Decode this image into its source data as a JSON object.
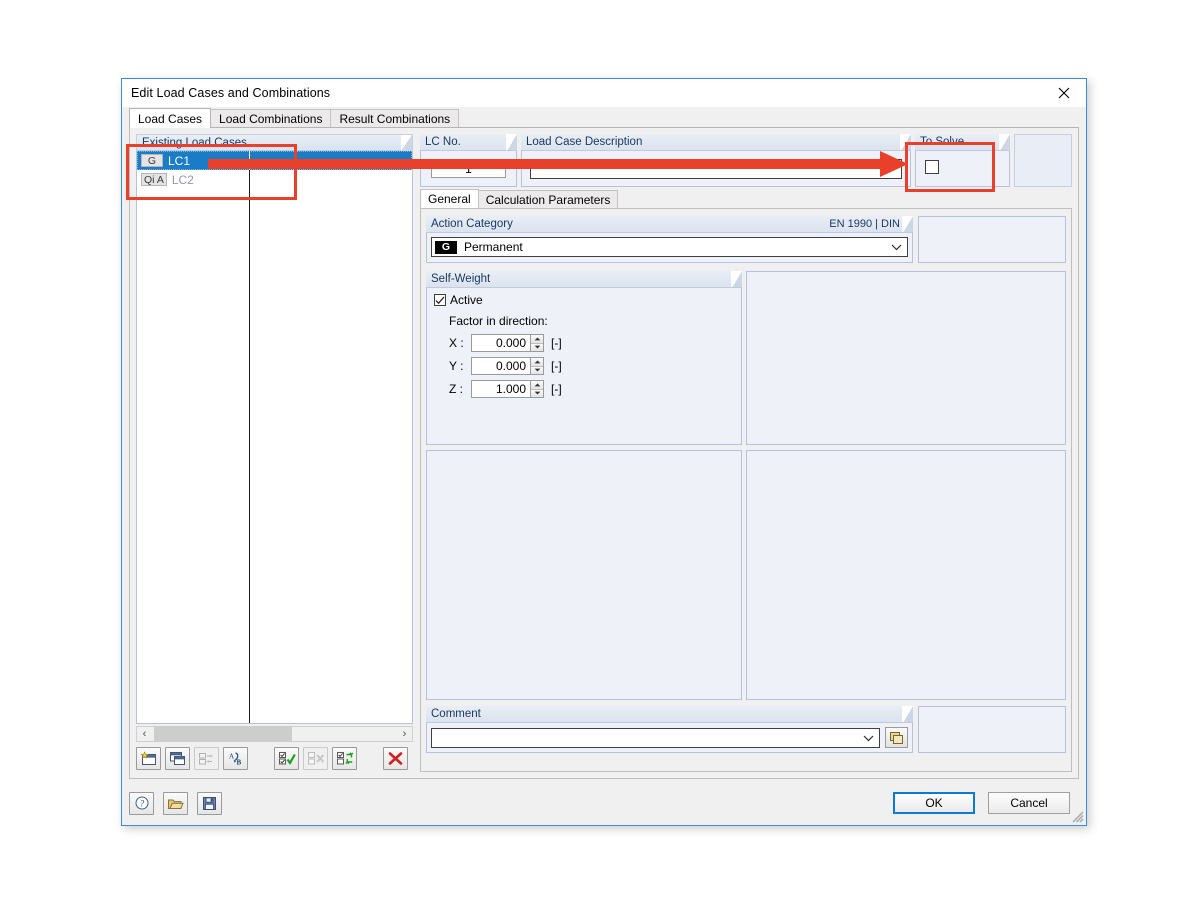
{
  "window": {
    "title": "Edit Load Cases and Combinations",
    "close_icon": "close-icon"
  },
  "tabs": [
    {
      "label": "Load Cases",
      "active": true
    },
    {
      "label": "Load Combinations",
      "active": false
    },
    {
      "label": "Result Combinations",
      "active": false
    }
  ],
  "left_panel": {
    "header": "Existing Load Cases",
    "rows": [
      {
        "badge": "G",
        "name": "LC1",
        "selected": true
      },
      {
        "badge": "Qi A",
        "name": "LC2",
        "selected": false
      }
    ],
    "scroll": {
      "left_arrow": "‹",
      "right_arrow": "›"
    },
    "toolbar": [
      {
        "name": "new-load-case-button",
        "icon": "new-window-icon"
      },
      {
        "name": "copy-load-case-button",
        "icon": "copy-window-icon"
      },
      {
        "name": "renumber-button",
        "icon": "renumber-icon",
        "disabled": true
      },
      {
        "name": "rename-button",
        "icon": "rename-ab-icon"
      },
      {
        "name": "select-all-button",
        "icon": "check-all-icon"
      },
      {
        "name": "deselect-all-button",
        "icon": "uncheck-all-icon",
        "disabled": true
      },
      {
        "name": "invert-selection-button",
        "icon": "invert-selection-icon"
      },
      {
        "name": "delete-load-case-button",
        "icon": "red-x-icon"
      }
    ]
  },
  "lc_no": {
    "header": "LC No.",
    "value": "1"
  },
  "description": {
    "header": "Load Case Description",
    "value": "",
    "caret": "chevron-down-icon"
  },
  "to_solve": {
    "header": "To Solve",
    "checked": false
  },
  "inner_tabs": [
    {
      "label": "General",
      "active": true
    },
    {
      "label": "Calculation Parameters",
      "active": false
    }
  ],
  "action_category": {
    "header": "Action Category",
    "header_right": "EN 1990 | DIN",
    "badge": "G",
    "value": "Permanent",
    "caret": "chevron-down-icon"
  },
  "self_weight": {
    "header": "Self-Weight",
    "active_label": "Active",
    "active_checked": true,
    "factor_label": "Factor in direction:",
    "factors": [
      {
        "axis": "X :",
        "value": "0.000",
        "unit": "[-]"
      },
      {
        "axis": "Y :",
        "value": "0.000",
        "unit": "[-]"
      },
      {
        "axis": "Z :",
        "value": "1.000",
        "unit": "[-]"
      }
    ]
  },
  "comment": {
    "header": "Comment",
    "value": "",
    "caret": "chevron-down-icon",
    "picker_icon": "comment-library-icon"
  },
  "footer": {
    "help_icon": "help-question-icon",
    "open_icon": "open-folder-icon",
    "save_icon": "save-floppy-icon",
    "ok_label": "OK",
    "cancel_label": "Cancel"
  },
  "annotations": {
    "color": "#e8402a",
    "highlight_list": "Existing Load Cases",
    "highlight_to_solve": "To Solve",
    "arrow": "right-arrow-annotation"
  }
}
